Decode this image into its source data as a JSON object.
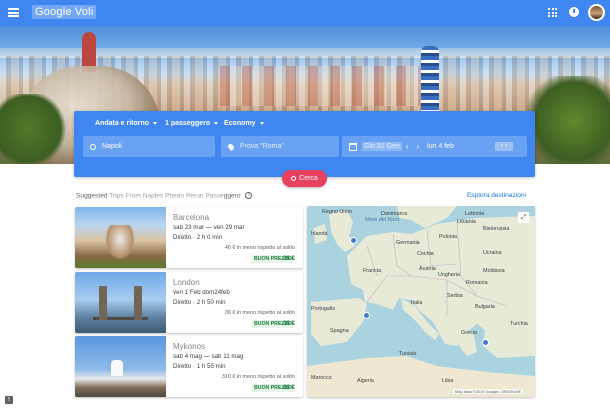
{
  "appbar": {
    "title": "Google Voli"
  },
  "search": {
    "trip_type": "Andata e ritorno",
    "passengers": "1 passeggero",
    "cabin": "Economy",
    "origin": "Napoli",
    "destination_placeholder": "Prova \"Roma\"",
    "depart_date": "Gio 31 Gen",
    "return_date": "lun 4 feb",
    "search_label": "Cerca"
  },
  "suggestions": {
    "heading_prefix": "Suggested",
    "heading_blur": "Trips From Naples Phedo Perun Passe",
    "heading_suffix": "ggero",
    "explore_label": "Esplora destinazioni"
  },
  "cards": [
    {
      "city": "Barcelona",
      "dates": "sab 23 mar — ven 29 mar",
      "flight": "Diretto · 2 h 0 min",
      "note": "46 € in meno rispetto al solito",
      "badge": "BUON PREZZO",
      "price": "36 €"
    },
    {
      "city": "London",
      "dates": "ven 1 Feb dom24feb",
      "flight": "Diretto · 2 h 50 min",
      "note": "36 € in meno rispetto al solito",
      "badge": "BUON PREZZO",
      "price": "36 €"
    },
    {
      "city": "Mykonos",
      "dates": "sab 4 mag — sab 11 mag",
      "flight": "Diretto · 1 h 55 min",
      "note": "310 € in meno rispetto al solito",
      "badge": "BUON PREZZO",
      "price": "88 €"
    }
  ],
  "map": {
    "labels": {
      "uk": "Regno Unito",
      "ireland": "Irlanda",
      "north_sea": "Mare del\nNord",
      "denmark": "Danimarca",
      "latvia": "Lettonia",
      "lithuania": "Lituania",
      "belarus": "Bielorussia",
      "poland": "Polonia",
      "germany": "Germania",
      "ukraine": "Ucraina",
      "czech": "Cechia",
      "france": "Francia",
      "austria": "Austria",
      "moldova": "Moldavia",
      "hungary": "Ungheria",
      "romania": "Romania",
      "serbia": "Serbia",
      "bulgaria": "Bulgaria",
      "italy": "Italia",
      "portugal": "Portogallo",
      "spain": "Spagna",
      "turkey": "Turchia",
      "greece": "Grecia",
      "tunisia": "Tunisia",
      "morocco": "Marocco",
      "algeria": "Algeria",
      "libya": "Libia"
    },
    "attribution": "Map data ©2019 Google, ORION-ME"
  },
  "colors": {
    "brand_blue": "#3f86f0",
    "search_red": "#e8415f",
    "price_green": "#188038"
  }
}
